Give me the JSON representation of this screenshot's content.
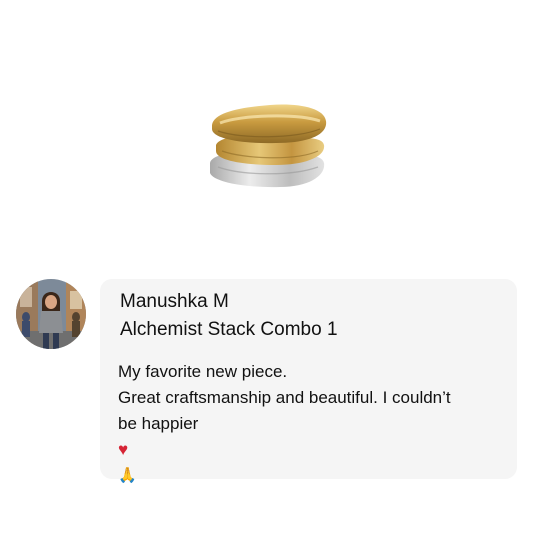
{
  "review": {
    "reviewer_name": "Manushka M",
    "product_name": "Alchemist Stack Combo 1",
    "text_line_1": "My favorite new piece.",
    "text_line_2": "Great craftsmanship and beautiful. I couldn’t",
    "text_line_3": "be happier",
    "emoji_heart": "♥",
    "emoji_pray": "🙏"
  },
  "icons": {
    "product": "stacked-rings-image",
    "avatar": "reviewer-photo"
  },
  "colors": {
    "card_background": "#f5f5f5",
    "text": "#111111",
    "heart": "#d62435",
    "gold": "#c9a24e",
    "silver": "#c9c9c9"
  }
}
